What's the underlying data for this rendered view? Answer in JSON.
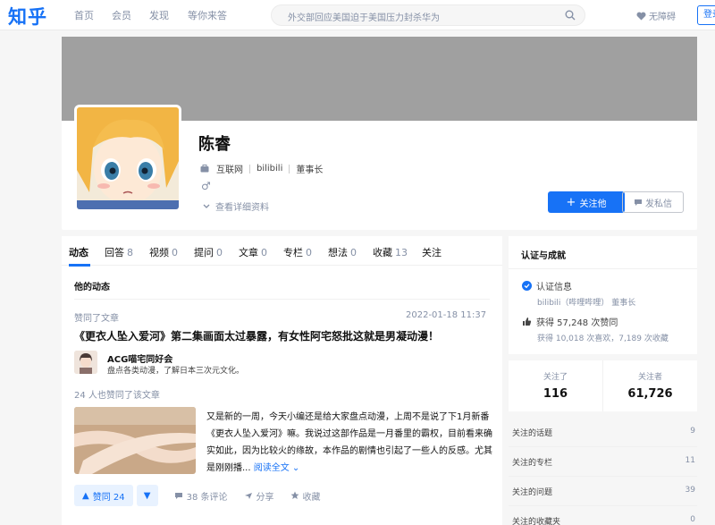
{
  "header": {
    "logo": "知乎",
    "nav": [
      "首页",
      "会员",
      "发现",
      "等你来答"
    ],
    "search_placeholder": "外交部回应美国迫于美国压力封杀华为",
    "accessibility": "无障碍",
    "login": "登录"
  },
  "profile": {
    "name": "陈睿",
    "industry": "互联网",
    "company": "bilibili",
    "position": "董事长",
    "gender_symbol": "♂",
    "detail_link": "查看详细资料",
    "follow_button": "关注他",
    "message_button": "发私信"
  },
  "tabs": [
    {
      "label": "动态",
      "count": ""
    },
    {
      "label": "回答",
      "count": "8"
    },
    {
      "label": "视频",
      "count": "0"
    },
    {
      "label": "提问",
      "count": "0"
    },
    {
      "label": "文章",
      "count": "0"
    },
    {
      "label": "专栏",
      "count": "0"
    },
    {
      "label": "想法",
      "count": "0"
    },
    {
      "label": "收藏",
      "count": "13"
    },
    {
      "label": "关注",
      "count": ""
    }
  ],
  "feed": {
    "section_title": "他的动态",
    "item": {
      "action": "赞同了文章",
      "time": "2022-01-18 11:37",
      "title": "《更衣人坠入爱河》第二集画面太过暴露，有女性阿宅怒批这就是男凝动漫！",
      "author_name": "ACG喵宅同好会",
      "author_bio": "盘点各类动漫，了解日本三次元文化。",
      "likers": "24 人也赞同了该文章",
      "excerpt": "又是新的一周，今天小编还是给大家盘点动漫，上周不是说了下1月新番《更衣人坠入爱河》嘛。我说过这部作品是一月番里的霸权，目前看来确实如此，因为比较火的缘故，本作品的剧情也引起了一些人的反感。尤其是刚刚播...",
      "read_more": "阅读全文",
      "vote_label": "赞同 24",
      "comments": "38 条评论",
      "share": "分享",
      "collect": "收藏"
    }
  },
  "achievements": {
    "title": "认证与成就",
    "verify_label": "认证信息",
    "verify_detail": "bilibili（哔哩哔哩） 董事长",
    "likes": "获得 57,248 次赞同",
    "likes_detail": "获得 10,018 次喜欢，7,189 次收藏"
  },
  "follow_stats": {
    "following_label": "关注了",
    "following": "116",
    "followers_label": "关注者",
    "followers": "61,726"
  },
  "side_links": [
    {
      "label": "关注的话题",
      "value": "9"
    },
    {
      "label": "关注的专栏",
      "value": "11"
    },
    {
      "label": "关注的问题",
      "value": "39"
    },
    {
      "label": "关注的收藏夹",
      "value": "0"
    }
  ],
  "colors": {
    "brand": "#1772f6",
    "cover": "#a0a0a0",
    "muted": "#8590a6"
  }
}
